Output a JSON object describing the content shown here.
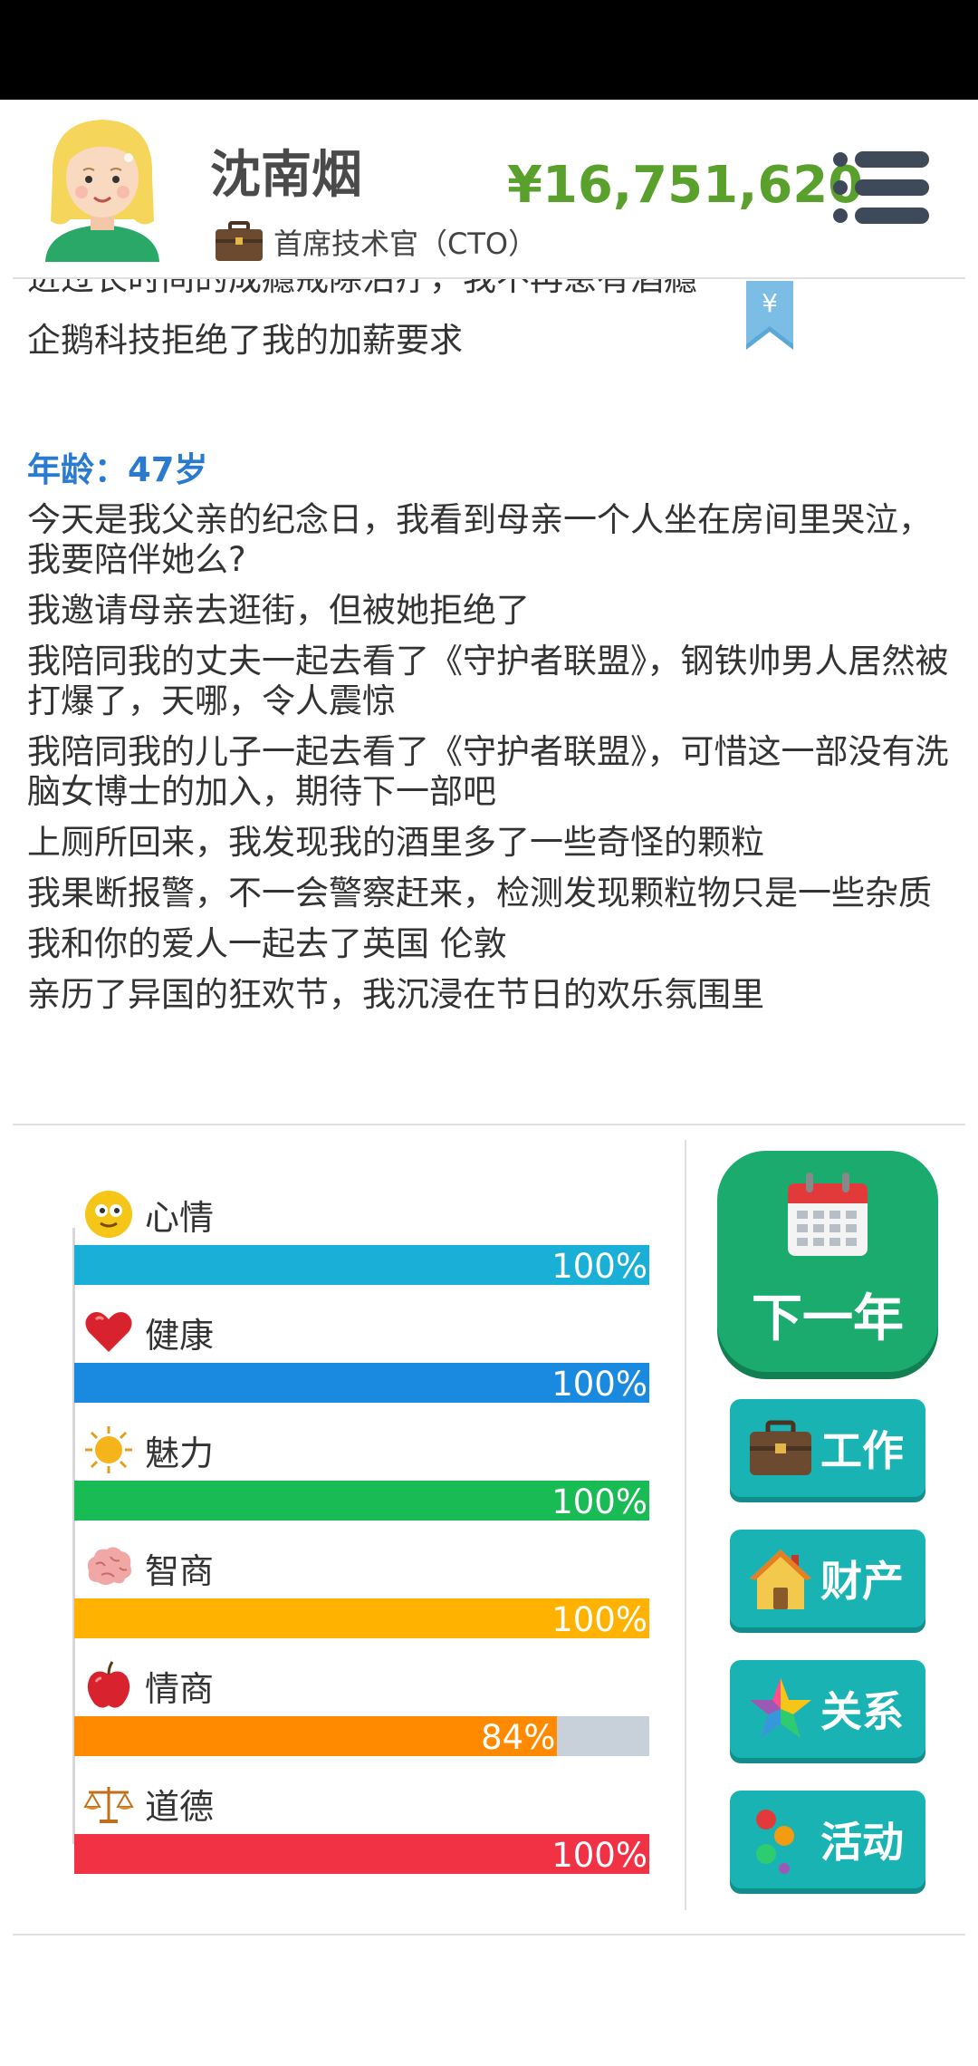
{
  "header": {
    "name": "沈南烟",
    "job_title": "首席技术官（CTO）",
    "money": "¥16,751,620",
    "icons": [
      "avatar-girl",
      "briefcase-icon",
      "menu-icon"
    ]
  },
  "log": {
    "partial_line": "进过长时间的成瘾戒除治疗，我不再患有酒瘾",
    "top_line": "企鹅科技拒绝了我的加薪要求",
    "ribbon_symbol": "¥",
    "age_label": "年龄：47岁",
    "entries": [
      "今天是我父亲的纪念日，我看到母亲一个人坐在房间里哭泣，我要陪伴她么?",
      "我邀请母亲去逛街，但被她拒绝了",
      "我陪同我的丈夫一起去看了《守护者联盟》，钢铁帅男人居然被打爆了，天哪，令人震惊",
      "我陪同我的儿子一起去看了《守护者联盟》，可惜这一部没有洗脑女博士的加入，期待下一部吧",
      "上厕所回来，我发现我的酒里多了一些奇怪的颗粒",
      "我果断报警，不一会警察赶来，检测发现颗粒物只是一些杂质",
      "我和你的爱人一起去了英国 伦敦",
      "亲历了异国的狂欢节，我沉浸在节日的欢乐氛围里"
    ]
  },
  "stats": [
    {
      "label": "心情",
      "value": 100,
      "display": "100%",
      "color": "#1aafd6",
      "icon": "smiley-icon"
    },
    {
      "label": "健康",
      "value": 100,
      "display": "100%",
      "color": "#1a8ae0",
      "icon": "heart-icon"
    },
    {
      "label": "魅力",
      "value": 100,
      "display": "100%",
      "color": "#19bb55",
      "icon": "sun-icon"
    },
    {
      "label": "智商",
      "value": 100,
      "display": "100%",
      "color": "#ffb300",
      "icon": "brain-icon"
    },
    {
      "label": "情商",
      "value": 84,
      "display": "84%",
      "color": "#ff8a00",
      "icon": "apple-icon"
    },
    {
      "label": "道德",
      "value": 100,
      "display": "100%",
      "color": "#f03244",
      "icon": "scale-icon"
    }
  ],
  "actions": {
    "next_year": "下一年",
    "work": "工作",
    "property": "财产",
    "relations": "关系",
    "activities": "活动"
  },
  "colors": {
    "money": "#5aa02c",
    "age": "#2a7ad0",
    "next_year_bg": "#1cab6f",
    "action_bg": "#1ab3b3"
  }
}
